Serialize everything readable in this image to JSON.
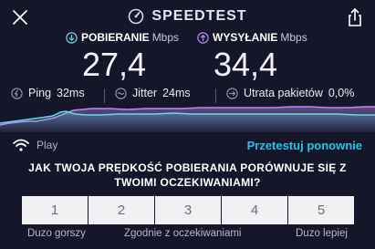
{
  "app": {
    "brand": "SPEEDTEST"
  },
  "icons": {
    "close": "close-icon",
    "share": "share-icon",
    "gauge": "speedometer-icon",
    "download": "download-arrow-icon",
    "upload": "upload-arrow-icon",
    "ping": "ping-icon",
    "jitter": "jitter-icon",
    "loss": "packet-loss-icon",
    "wifi": "wifi-icon"
  },
  "colors": {
    "background": "#16162a",
    "download": "#5fdcea",
    "upload": "#b98af2",
    "accent": "#1ec8e6"
  },
  "download": {
    "label": "POBIERANIE",
    "unit": "Mbps",
    "value": "27,4"
  },
  "upload": {
    "label": "WYSYŁANIE",
    "unit": "Mbps",
    "value": "34,4"
  },
  "stats": {
    "ping": {
      "label": "Ping",
      "value": "32ms"
    },
    "jitter": {
      "label": "Jitter",
      "value": "24ms"
    },
    "loss": {
      "label": "Utrata pakietów",
      "value": "0,0%"
    }
  },
  "network": {
    "name": "Play",
    "retest_label": "Przetestuj ponownie"
  },
  "survey": {
    "question": "JAK TWOJA PRĘDKOŚĆ POBIERANIA PORÓWNUJE SIĘ Z TWOIMI OCZEKIWANIAMI?",
    "options": [
      "1",
      "2",
      "3",
      "4",
      "5"
    ],
    "low_label": "Duzo gorszy",
    "mid_label": "Zgodnie z oczekiwaniami",
    "high_label": "Duzo lepiej"
  }
}
